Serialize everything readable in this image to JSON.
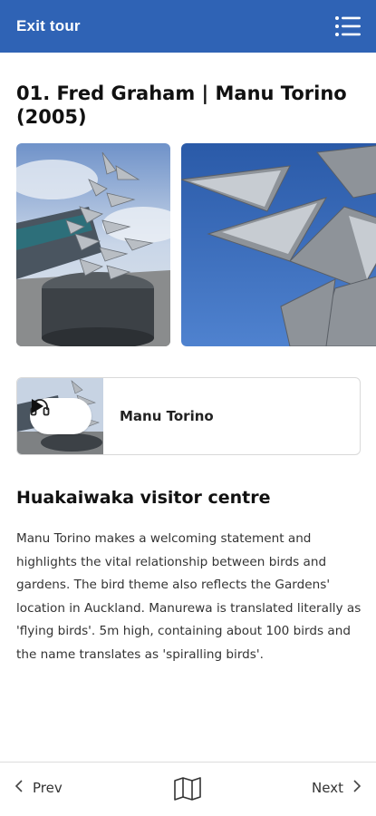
{
  "header": {
    "exit_label": "Exit tour",
    "menu_icon": "list-menu-icon",
    "background": "#2f63b5"
  },
  "stop": {
    "title": "01. Fred Graham | Manu Torino (2005)"
  },
  "gallery": {
    "images": [
      {
        "icon": "sculpture-photo"
      },
      {
        "icon": "sculpture-closeup-photo"
      }
    ]
  },
  "audio": {
    "title": "Manu Torino",
    "icons": [
      "headphones-icon",
      "play-icon"
    ]
  },
  "section": {
    "heading": "Huakaiwaka visitor centre",
    "body": "Manu Torino makes a welcoming statement and highlights the vital relationship between birds and gardens. The bird theme also reflects the Gardens' location in Auckland. Manurewa is translated literally as 'flying birds'. 5m high, containing about 100 birds and the name translates as 'spiralling birds'."
  },
  "footer": {
    "prev_label": "Prev",
    "next_label": "Next",
    "map_icon": "map-icon"
  }
}
